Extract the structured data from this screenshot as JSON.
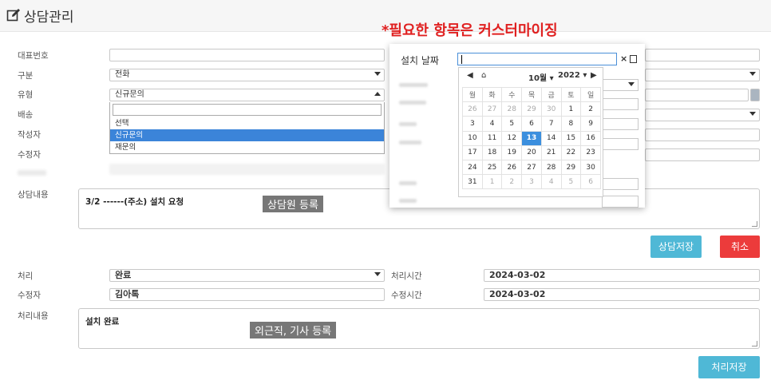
{
  "header": {
    "title": "상담관리"
  },
  "notice": "*필요한 항목은 커스터마이징",
  "form": {
    "labels": {
      "rep_number": "대표번호",
      "category": "구분",
      "type": "유형",
      "delivery": "배송",
      "author": "작성자",
      "editor": "수정자",
      "consult_content": "상담내용"
    },
    "category_value": "전화",
    "type_value": "신규문의",
    "type_options": [
      "선택",
      "신규문의",
      "재문의"
    ],
    "consult_text": "3/2 ------(주소) 설치 요청",
    "consult_tag": "상담원 등록",
    "save_consult_label": "상담저장",
    "cancel_label": "취소"
  },
  "process": {
    "labels": {
      "process": "처리",
      "editor": "수정자",
      "content": "처리내용",
      "process_time": "처리시간",
      "edit_time": "수정시간"
    },
    "status_value": "완료",
    "editor_value": "김아톡",
    "process_time_value": "2024-03-02",
    "edit_time_value": "2024-03-02",
    "content_text": "설치 완료",
    "content_tag": "외근직, 기사 등록",
    "save_label": "처리저장"
  },
  "date_popup": {
    "label": "설치 날짜",
    "clear": "×",
    "month_label": "10월",
    "year_label": "2022",
    "weekdays": [
      "월",
      "화",
      "수",
      "목",
      "금",
      "토",
      "일"
    ],
    "weeks": [
      [
        "26",
        "27",
        "28",
        "29",
        "30",
        "1",
        "2"
      ],
      [
        "3",
        "4",
        "5",
        "6",
        "7",
        "8",
        "9"
      ],
      [
        "10",
        "11",
        "12",
        "13",
        "14",
        "15",
        "16"
      ],
      [
        "17",
        "18",
        "19",
        "20",
        "21",
        "22",
        "23"
      ],
      [
        "24",
        "25",
        "26",
        "27",
        "28",
        "29",
        "30"
      ],
      [
        "31",
        "1",
        "2",
        "3",
        "4",
        "5",
        "6"
      ]
    ],
    "selected": "13"
  },
  "colors": {
    "notice": "#e02020",
    "selected_day": "#3b8fde",
    "info_button": "#4fb8d6",
    "danger_button": "#ec3b3b",
    "dropdown_active": "#3b84d9"
  }
}
